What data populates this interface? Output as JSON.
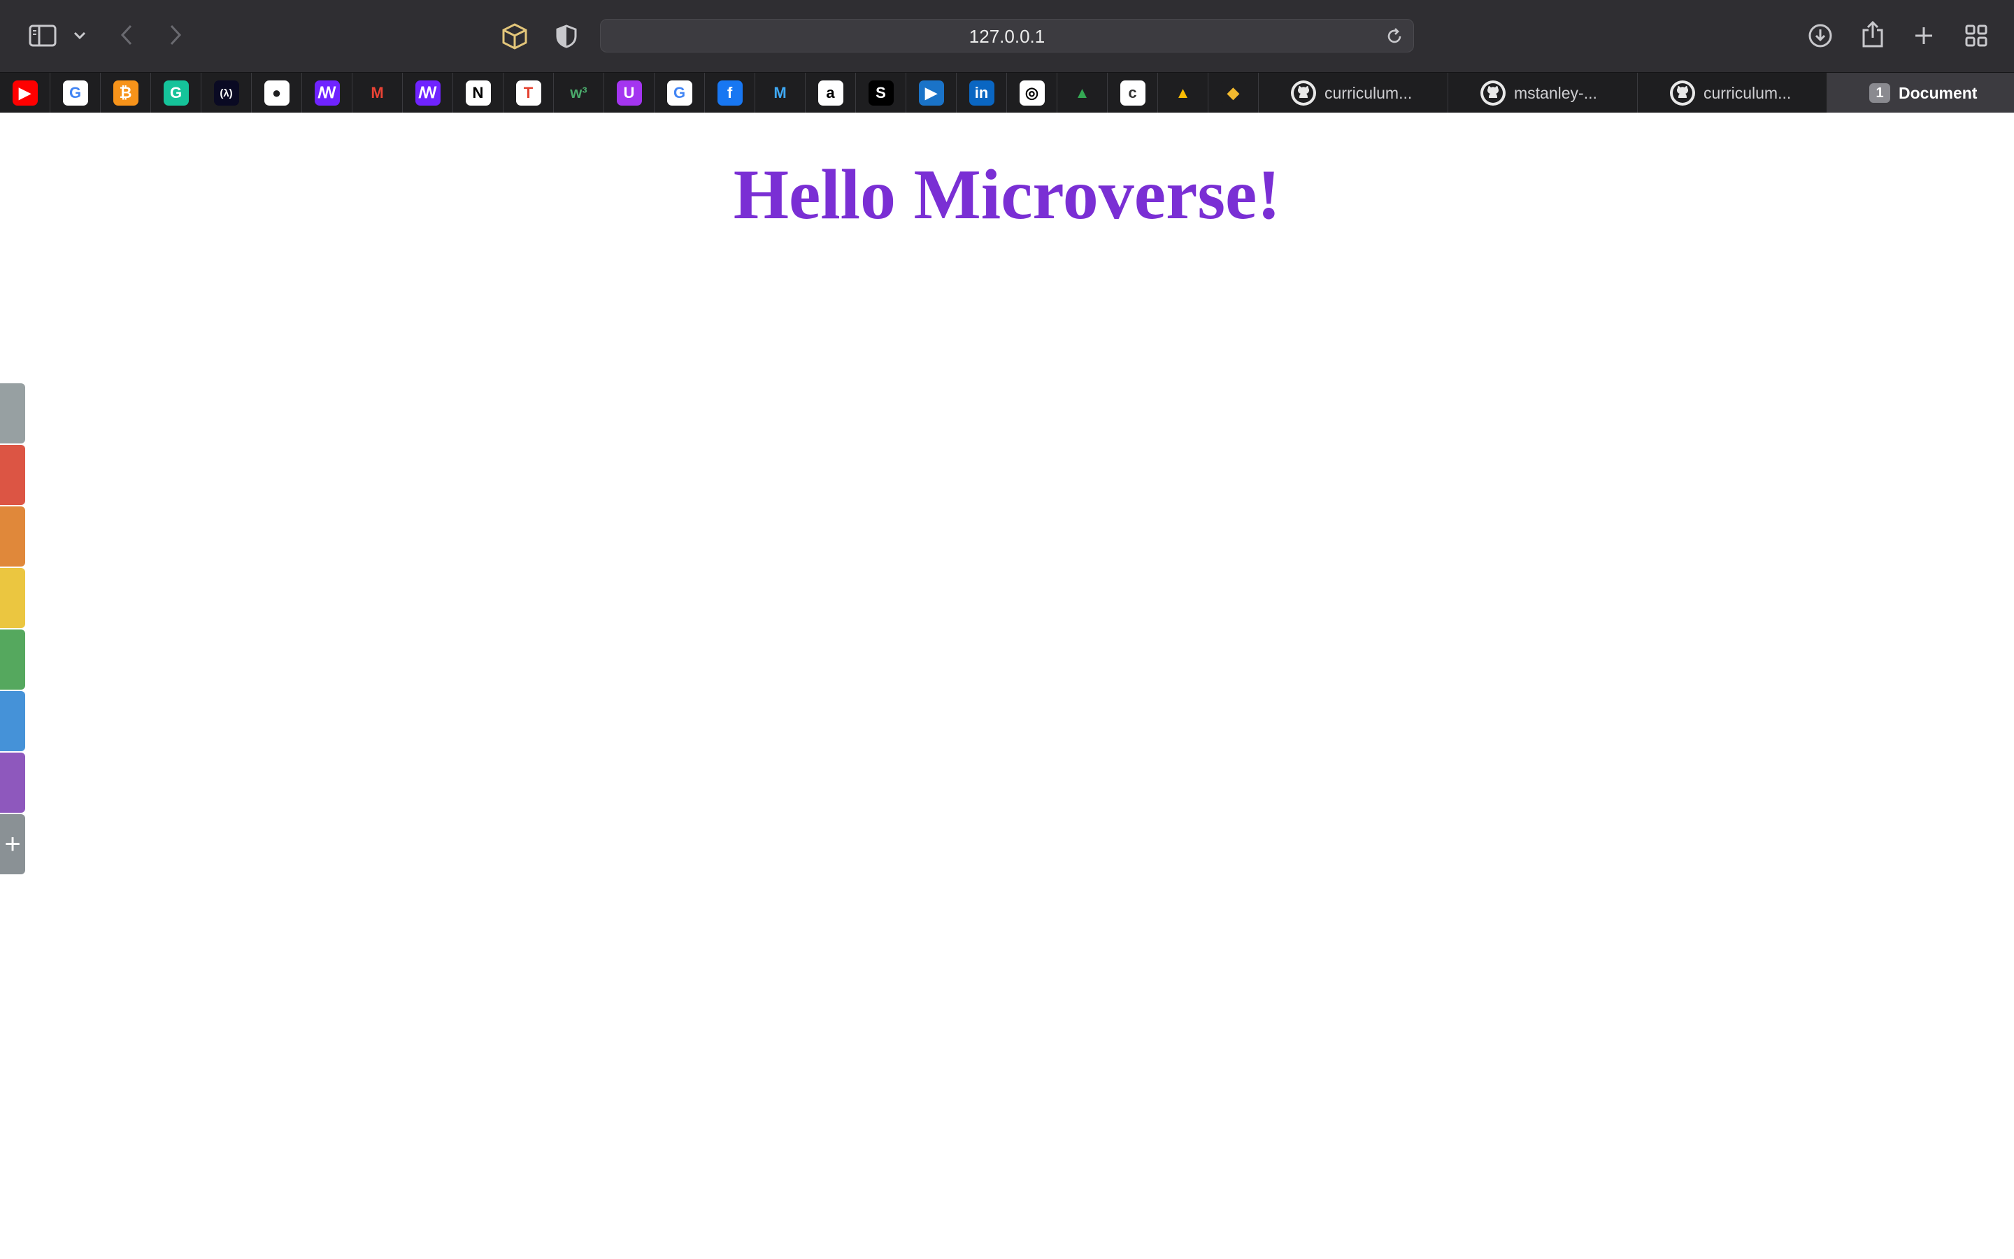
{
  "browser": {
    "url": "127.0.0.1",
    "toolbar_icons": [
      "sidebar-icon",
      "chevron-down-icon",
      "back-icon",
      "forward-icon",
      "extension-box-icon",
      "shield-icon",
      "reload-icon",
      "download-icon",
      "share-icon",
      "plus-icon",
      "tab-overview-icon"
    ]
  },
  "pinned_tabs": [
    {
      "name": "youtube",
      "icon": "youtube-icon",
      "glyph": "▶",
      "bg": "#ff0000",
      "fg": "#ffffff"
    },
    {
      "name": "google",
      "icon": "google-icon",
      "glyph": "G",
      "bg": "#ffffff",
      "fg": "#4285f4"
    },
    {
      "name": "bitcoin",
      "icon": "bitcoin-icon",
      "glyph": "₿",
      "bg": "#f7931a",
      "fg": "#ffffff"
    },
    {
      "name": "grammarly",
      "icon": "grammarly-icon",
      "glyph": "G",
      "bg": "#15c39a",
      "fg": "#ffffff"
    },
    {
      "name": "freecodecamp",
      "icon": "freecodecamp-icon",
      "glyph": "(λ)",
      "bg": "#0a0a23",
      "fg": "#ffffff"
    },
    {
      "name": "github",
      "icon": "github-icon",
      "glyph": "●",
      "bg": "#ffffff",
      "fg": "#1e1e20"
    },
    {
      "name": "microverse",
      "icon": "microverse-icon",
      "glyph": "ꟿ",
      "bg": "#6f23ff",
      "fg": "#ffffff"
    },
    {
      "name": "gmail",
      "icon": "gmail-icon",
      "glyph": "M",
      "bg": "#1e1e20",
      "fg": "#ea4335"
    },
    {
      "name": "microverse-2",
      "icon": "microverse-icon",
      "glyph": "ꟿ",
      "bg": "#6f23ff",
      "fg": "#ffffff"
    },
    {
      "name": "notion",
      "icon": "notion-icon",
      "glyph": "N",
      "bg": "#ffffff",
      "fg": "#000000"
    },
    {
      "name": "todoist",
      "icon": "todoist-icon",
      "glyph": "T",
      "bg": "#ffffff",
      "fg": "#e44332"
    },
    {
      "name": "w3schools",
      "icon": "w3schools-icon",
      "glyph": "w³",
      "bg": "#1e1e20",
      "fg": "#4aaa6b"
    },
    {
      "name": "udemy",
      "icon": "udemy-icon",
      "glyph": "U",
      "bg": "#a435f0",
      "fg": "#ffffff"
    },
    {
      "name": "google-2",
      "icon": "google-icon",
      "glyph": "G",
      "bg": "#ffffff",
      "fg": "#4285f4"
    },
    {
      "name": "facebook",
      "icon": "facebook-icon",
      "glyph": "f",
      "bg": "#1877f2",
      "fg": "#ffffff"
    },
    {
      "name": "malwarebytes",
      "icon": "malwarebytes-icon",
      "glyph": "M",
      "bg": "#1e1e20",
      "fg": "#3fa9f5"
    },
    {
      "name": "amazon",
      "icon": "amazon-icon",
      "glyph": "a",
      "bg": "#ffffff",
      "fg": "#000000"
    },
    {
      "name": "scribd",
      "icon": "scribd-icon",
      "glyph": "S",
      "bg": "#000000",
      "fg": "#ffffff"
    },
    {
      "name": "video",
      "icon": "video-icon",
      "glyph": "▶",
      "bg": "#1a73c8",
      "fg": "#ffffff"
    },
    {
      "name": "linkedin",
      "icon": "linkedin-icon",
      "glyph": "in",
      "bg": "#0a66c2",
      "fg": "#ffffff"
    },
    {
      "name": "instagram",
      "icon": "instagram-icon",
      "glyph": "◎",
      "bg": "#ffffff",
      "fg": "#000000"
    },
    {
      "name": "google-drive",
      "icon": "google-drive-icon",
      "glyph": "▲",
      "bg": "#1e1e20",
      "fg": "#34a853"
    },
    {
      "name": "codeanywhere",
      "icon": "codeanywhere-icon",
      "glyph": "c",
      "bg": "#ffffff",
      "fg": "#333333"
    },
    {
      "name": "google-drive-2",
      "icon": "google-drive-icon",
      "glyph": "▲",
      "bg": "#1e1e20",
      "fg": "#fbbc04"
    },
    {
      "name": "binance",
      "icon": "binance-icon",
      "glyph": "◆",
      "bg": "#1e1e20",
      "fg": "#f3ba2f"
    }
  ],
  "tabs": [
    {
      "label": "curriculum...",
      "icon": "github-icon",
      "active": false
    },
    {
      "label": "mstanley-...",
      "icon": "github-icon",
      "active": false
    },
    {
      "label": "curriculum...",
      "icon": "github-icon",
      "active": false
    },
    {
      "label": "Document",
      "badge": "1",
      "active": true
    }
  ],
  "page": {
    "heading": "Hello Microverse!",
    "heading_color": "#7a2fd4"
  },
  "side_tabs": {
    "colors": [
      "#97a0a2",
      "#dc5544",
      "#e0883a",
      "#ebc640",
      "#55a85e",
      "#4592d8",
      "#8e58bd",
      "#8a9195"
    ],
    "add_glyph": "+"
  }
}
